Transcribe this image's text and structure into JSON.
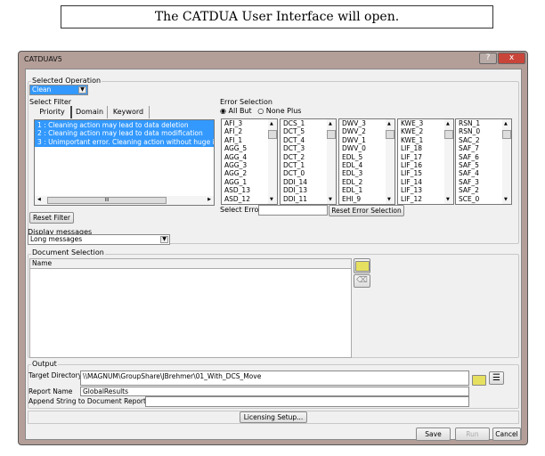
{
  "caption": "The CATDUA User Interface will open.",
  "window": {
    "title": "CATDUAV5",
    "help_label": "?",
    "close_label": "x"
  },
  "operation": {
    "group_label": "Selected Operation",
    "selected": "Clean"
  },
  "filter": {
    "label": "Select Filter",
    "tabs": [
      {
        "label": "Priority",
        "active": true
      },
      {
        "label": "Domain"
      },
      {
        "label": "Keyword"
      }
    ],
    "items": [
      "1 : Cleaning action may lead to data deletion",
      "2 : Cleaning action may lead to data modification",
      "3 : Unimportant error. Cleaning action without huge im"
    ],
    "scroll_thumb": "III",
    "reset_label": "Reset Filter"
  },
  "display": {
    "label": "Display messages",
    "selected": "Long messages"
  },
  "errors": {
    "label": "Error Selection",
    "radio_all_but": "All But",
    "radio_none_plus": "None Plus",
    "selected_radio": "All But",
    "lists": [
      [
        "AFI_3",
        "AFI_2",
        "AFI_1",
        "AGG_5",
        "AGG_4",
        "AGG_3",
        "AGG_2",
        "AGG_1",
        "ASD_13",
        "ASD_12"
      ],
      [
        "DCS_1",
        "DCT_5",
        "DCT_4",
        "DCT_3",
        "DCT_2",
        "DCT_1",
        "DCT_0",
        "DDI_14",
        "DDI_13",
        "DDI_11"
      ],
      [
        "DWV_3",
        "DWV_2",
        "DWV_1",
        "DWV_0",
        "EDL_5",
        "EDL_4",
        "EDL_3",
        "EDL_2",
        "EDL_1",
        "EHI_9"
      ],
      [
        "KWE_3",
        "KWE_2",
        "KWE_1",
        "LIF_18",
        "LIF_17",
        "LIF_16",
        "LIF_15",
        "LIF_14",
        "LIF_13",
        "LIF_12"
      ],
      [
        "RSN_1",
        "RSN_0",
        "SAC_2",
        "SAF_7",
        "SAF_6",
        "SAF_5",
        "SAF_4",
        "SAF_3",
        "SAF_2",
        "SCE_0"
      ]
    ],
    "select_error_label": "Select Error",
    "select_error_value": "",
    "reset_label": "Reset Error Selection"
  },
  "documents": {
    "group_label": "Document Selection",
    "column_name": "Name",
    "add_icon": "folder-icon",
    "clear_icon": "eraser-icon"
  },
  "output": {
    "group_label": "Output",
    "target_label": "Target Directory",
    "target_value": "\\\\MAGNUM\\GroupShare\\JBrehmer\\01_With_DCS_Move",
    "report_label": "Report Name",
    "report_value": "GlobalResults",
    "append_label": "Append String to Document Report",
    "append_value": ""
  },
  "licensing_label": "Licensing Setup...",
  "buttons": {
    "save": "Save",
    "run": "Run",
    "cancel": "Cancel"
  },
  "colors": {
    "selection": "#3399ff",
    "close_button": "#c9453a"
  }
}
